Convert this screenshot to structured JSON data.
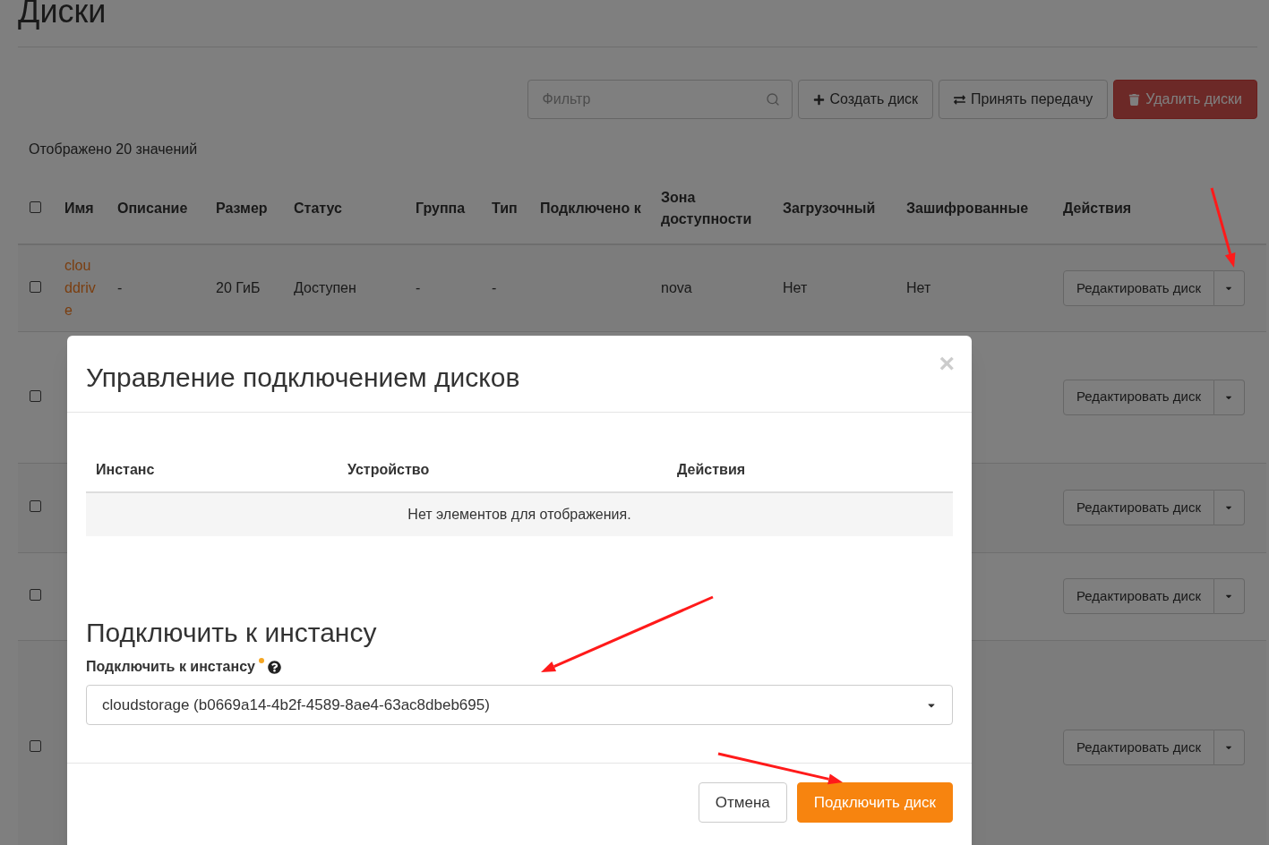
{
  "page": {
    "title": "Диски"
  },
  "toolbar": {
    "filter": {
      "placeholder": "Фильтр"
    },
    "buttons": [
      {
        "kind": "create",
        "label": "Создать диск"
      },
      {
        "kind": "transfer",
        "label": "Принять передачу"
      },
      {
        "kind": "delete",
        "label": "Удалить диски"
      }
    ]
  },
  "count_text": "Отображено 20 значений",
  "table": {
    "select_all": {
      "checked": false
    },
    "columns": [
      "Имя",
      "Описание",
      "Размер",
      "Статус",
      "Группа",
      "Тип",
      "Подключено к",
      "Зона доступности",
      "Загрузочный",
      "Зашифрованные",
      "Действия"
    ],
    "rows": [
      {
        "checked": false,
        "cells": [
          "clouddrive",
          "-",
          "20 ГиБ",
          "Доступен",
          "-",
          "-",
          "",
          "nova",
          "Нет",
          "Нет"
        ],
        "action": "Редактировать диск"
      },
      {
        "checked": false,
        "action": "Редактировать диск"
      },
      {
        "checked": false,
        "action": "Редактировать диск"
      },
      {
        "checked": false,
        "action": "Редактировать диск"
      },
      {
        "checked": false,
        "action": "Редактировать диск"
      }
    ]
  },
  "modal": {
    "title": "Управление подключением дисков",
    "close": "×",
    "attachments": {
      "columns": [
        "Инстанс",
        "Устройство",
        "Действия"
      ],
      "empty_text": "Нет элементов для отображения."
    },
    "section_title": "Подключить к инстансу",
    "field": {
      "label": "Подключить к инстансу",
      "required": true,
      "value": "cloudstorage (b0669a14-4b2f-4589-8ae4-63ac8dbeb695)"
    },
    "buttons": [
      {
        "kind": "cancel",
        "label": "Отмена"
      },
      {
        "kind": "primary",
        "label": "Подключить диск"
      }
    ]
  }
}
